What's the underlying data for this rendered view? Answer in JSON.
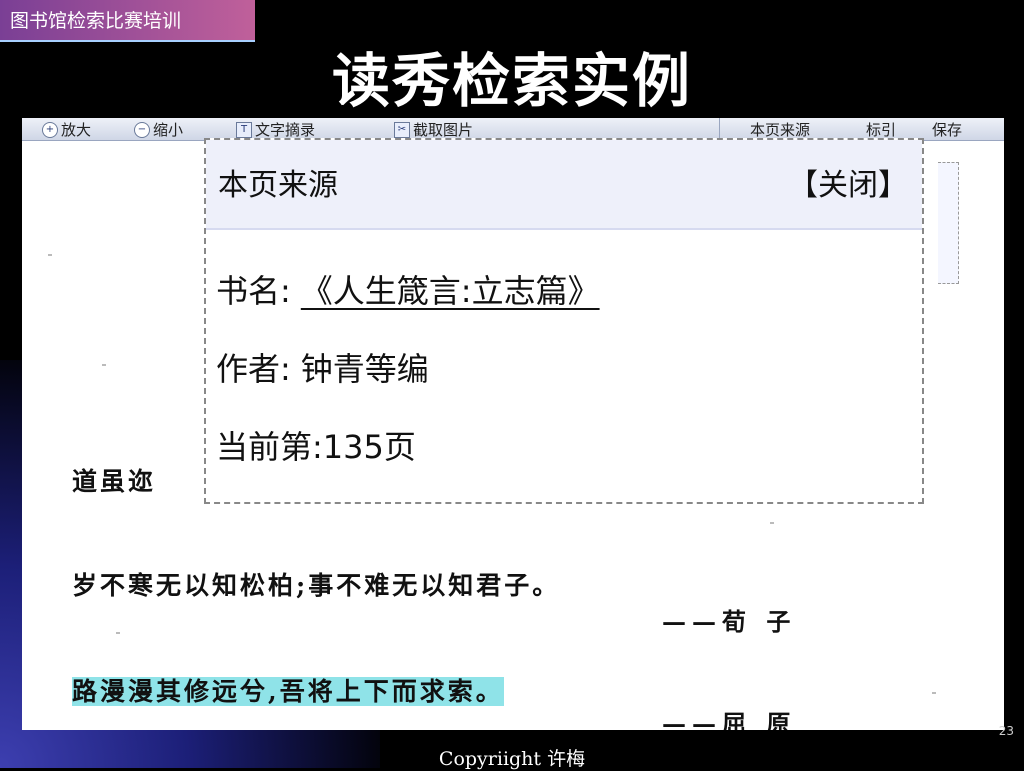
{
  "slide": {
    "course_tag": "图书馆检索比赛培训",
    "title": "读秀检索实例",
    "footer": "Copyriight 许梅",
    "page_number": "23"
  },
  "toolbar": {
    "zoom_in": "放大",
    "zoom_out": "缩小",
    "text_extract": "文字摘录",
    "capture_image": "截取图片",
    "page_source": "本页来源",
    "bookmark": "标引",
    "save": "保存"
  },
  "popup": {
    "title": "本页来源",
    "close_label": "【关闭】",
    "book_label": "书名:",
    "book_title": "《人生箴言:立志篇》",
    "author_label": "作者:",
    "author": "钟青等编",
    "page_label": "当前第:135页"
  },
  "page_text": {
    "partial_line": "道虽迩",
    "line1": "岁不寒无以知松柏;事不难无以知君子。",
    "attr1": "——荀 子",
    "line2": "路漫漫其修远兮,吾将上下而求索。",
    "attr2": "——屈 原"
  }
}
